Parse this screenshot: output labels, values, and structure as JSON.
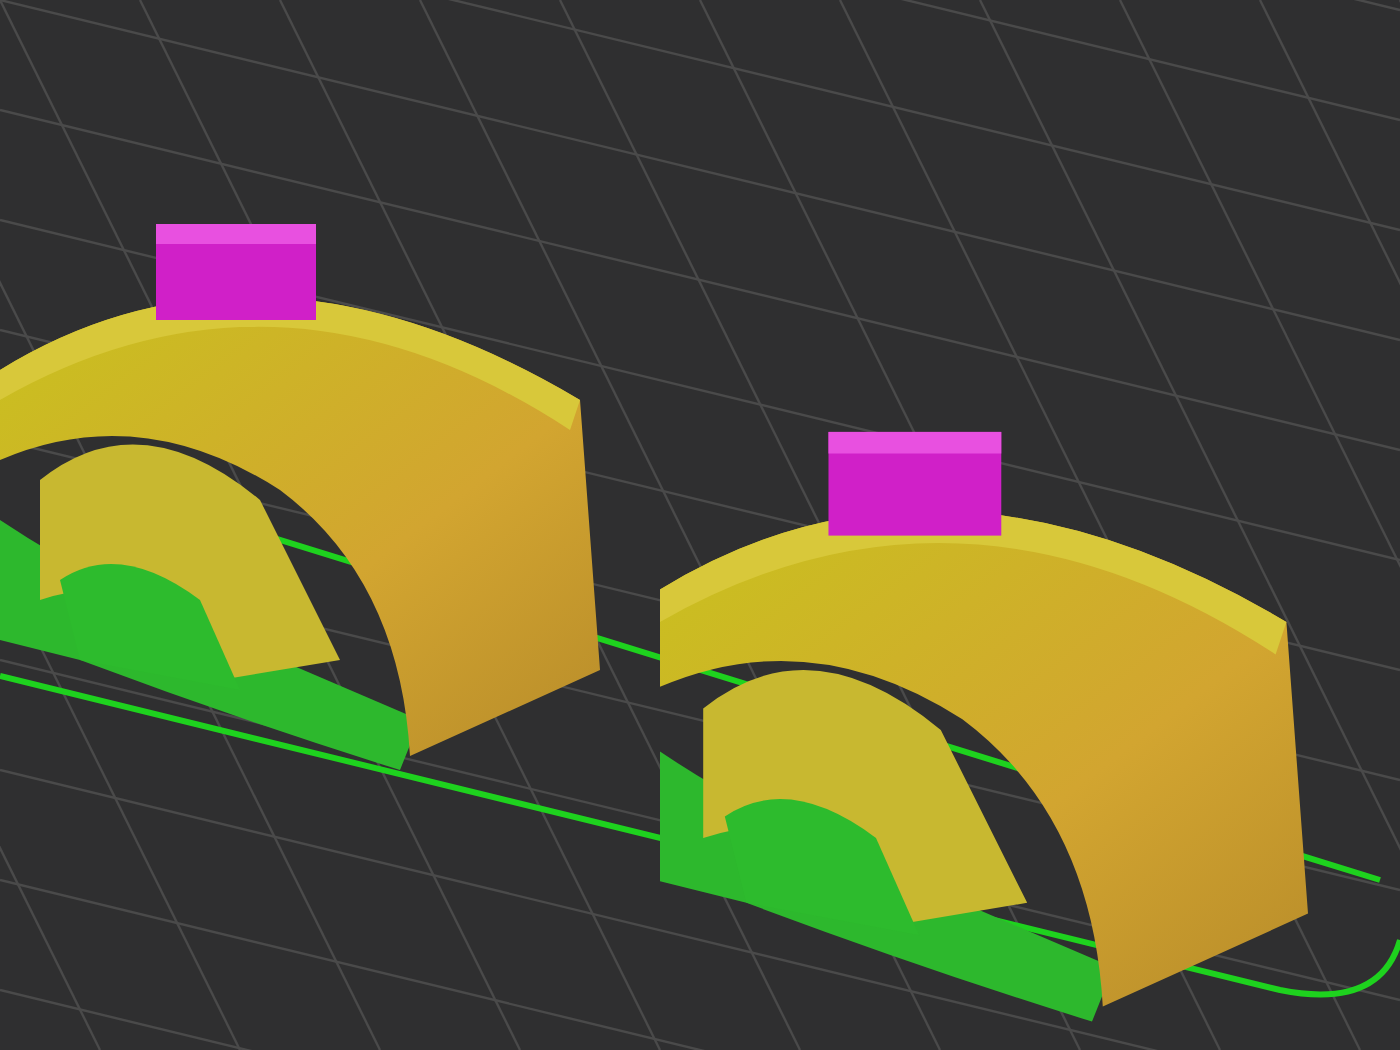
{
  "scene": {
    "parts": [
      {
        "kind": "arch"
      },
      {
        "kind": "arch"
      }
    ]
  }
}
